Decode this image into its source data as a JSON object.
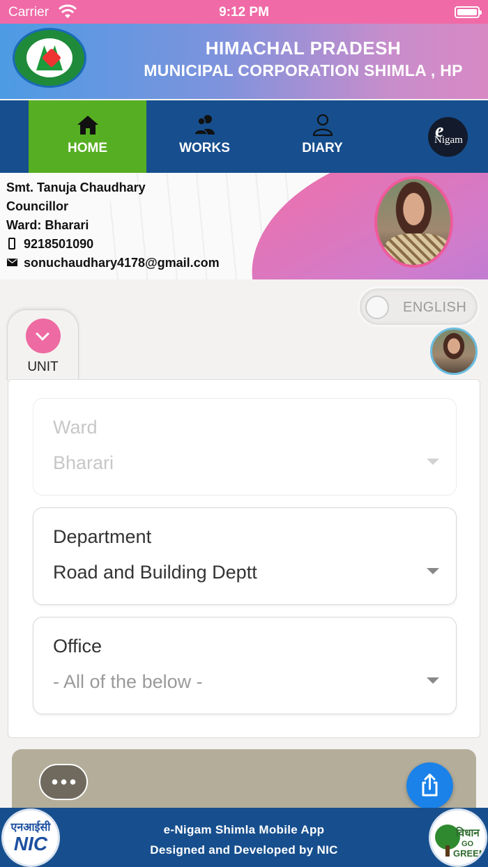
{
  "status_bar": {
    "carrier": "Carrier",
    "time": "9:12 PM"
  },
  "header": {
    "title": "HIMACHAL PRADESH",
    "subtitle": "MUNICIPAL CORPORATION SHIMLA , HP"
  },
  "nav": {
    "items": [
      {
        "label": "HOME",
        "icon": "home-icon",
        "active": true
      },
      {
        "label": "WORKS",
        "icon": "users-icon",
        "active": false
      },
      {
        "label": "DIARY",
        "icon": "person-icon",
        "active": false
      }
    ],
    "logo": {
      "e": "e",
      "text": "Nigam"
    }
  },
  "profile": {
    "name": "Smt. Tanuja Chaudhary",
    "designation": "Councillor",
    "ward": "Ward: Bharari",
    "phone": "9218501090",
    "email": "sonuchaudhary4178@gmail.com"
  },
  "language_toggle": {
    "label": "ENGLISH"
  },
  "unit_tab": {
    "label": "UNIT"
  },
  "form": {
    "ward": {
      "label": "Ward",
      "value": "Bharari",
      "disabled": true
    },
    "department": {
      "label": "Department",
      "value": "Road and Building Deptt"
    },
    "office": {
      "label": "Office",
      "value": "- All of the below -"
    }
  },
  "footer": {
    "line1": "e-Nigam Shimla Mobile App",
    "line2": "Designed and Developed by NIC",
    "nic_logo": {
      "hindi": "एनआईसी",
      "text": "NIC"
    },
    "green_logo": {
      "hindi": "विधान",
      "go": "GO",
      "green": "GREEN"
    }
  },
  "colors": {
    "status_bar": "#ef6aa6",
    "nav_bg": "#174f8e",
    "nav_active": "#56ae22",
    "accent_pink": "#ee6aa2",
    "share_blue": "#1a82e8"
  }
}
